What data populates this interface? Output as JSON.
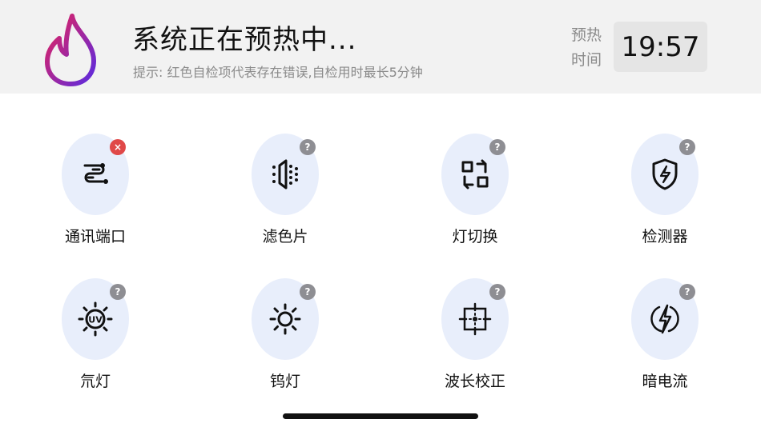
{
  "header": {
    "title": "系统正在预热中...",
    "hint": "提示: 红色自检项代表存在错误,自检用时最长5分钟",
    "timer_label_line1": "预热",
    "timer_label_line2": "时间",
    "timer_value": "19:57"
  },
  "colors": {
    "flame_gradient_start": "#e8235a",
    "flame_gradient_end": "#5b2be0",
    "tile_bg": "#e8eefb",
    "error_badge": "#e04848",
    "question_badge": "#8e8e93"
  },
  "tiles": [
    {
      "label": "通讯端口",
      "icon": "port-icon",
      "badge": "×",
      "status": "error"
    },
    {
      "label": "滤色片",
      "icon": "filter-icon",
      "badge": "?",
      "status": "unknown"
    },
    {
      "label": "灯切换",
      "icon": "switch-icon",
      "badge": "?",
      "status": "unknown"
    },
    {
      "label": "检测器",
      "icon": "shield-bolt-icon",
      "badge": "?",
      "status": "unknown"
    },
    {
      "label": "氘灯",
      "icon": "uv-lamp-icon",
      "badge": "?",
      "status": "unknown"
    },
    {
      "label": "钨灯",
      "icon": "sun-icon",
      "badge": "?",
      "status": "unknown"
    },
    {
      "label": "波长校正",
      "icon": "target-icon",
      "badge": "?",
      "status": "unknown"
    },
    {
      "label": "暗电流",
      "icon": "bolt-circle-icon",
      "badge": "?",
      "status": "unknown"
    }
  ]
}
